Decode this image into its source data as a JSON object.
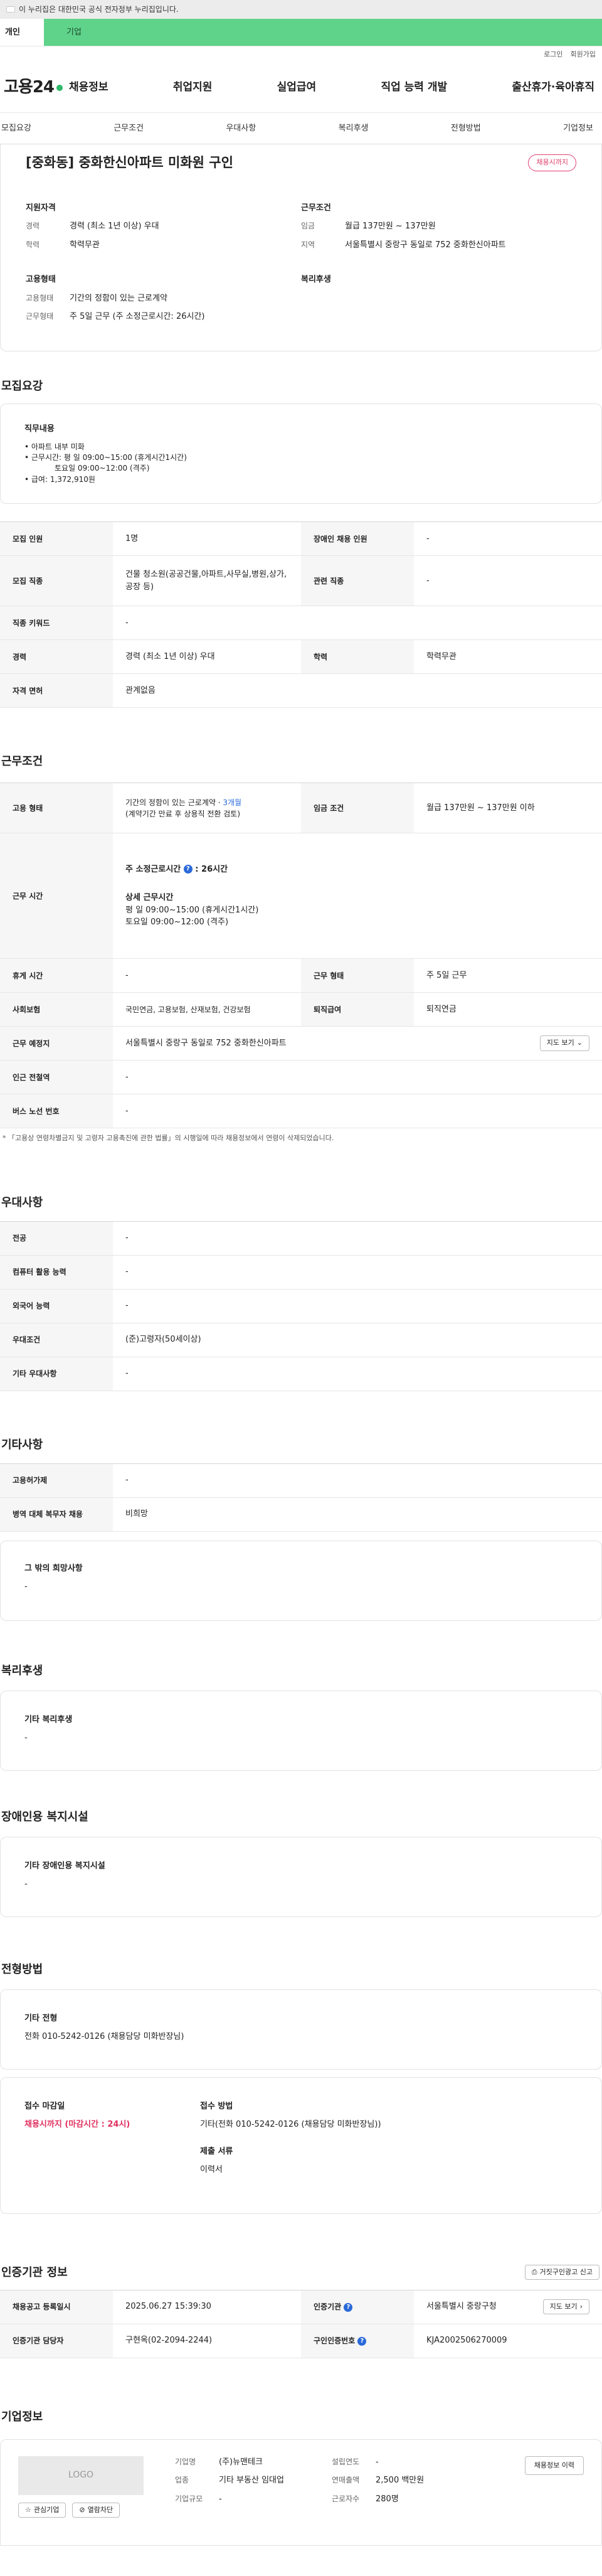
{
  "gov_banner": "이 누리집은 대한민국 공식 전자정부 누리집입니다.",
  "site_tabs": {
    "personal": "개인",
    "company": "기업"
  },
  "util": {
    "login": "로그인",
    "join": "회원가입"
  },
  "logo": "고용24",
  "gnb": [
    "채용정보",
    "취업지원",
    "실업급여",
    "직업 능력 개발",
    "출산휴가·육아휴직"
  ],
  "snb": [
    "모집요강",
    "근무조건",
    "우대사항",
    "복리후생",
    "전형방법",
    "기업정보"
  ],
  "title": "[중화동] 중화한신아파트 미화원 구인",
  "status_badge": "채용시까지",
  "summary": {
    "qual_title": "지원자격",
    "career_k": "경력",
    "career_v": "경력 (최소 1년 이상) 우대",
    "edu_k": "학력",
    "edu_v": "학력무관",
    "cond_title": "근무조건",
    "wage_k": "임금",
    "wage_v": "월급 137만원 ~ 137만원",
    "region_k": "지역",
    "region_v": "서울특별시 중랑구 동일로 752 중화한신아파트",
    "form_title": "고용형태",
    "emp_k": "고용형태",
    "emp_v": "기간의 정함이 있는 근로계약",
    "work_k": "근무형태",
    "work_v": "주 5일 근무 (주 소정근로시간: 26시간)",
    "welfare_title": "복리후생"
  },
  "recruit": {
    "title": "모집요강",
    "duty_title": "직무내용",
    "duty_lines": [
      "• 아파트 내부 미화",
      "• 근무시간: 평    일 09:00~15:00 (휴게시간1시간)",
      "토요일 09:00~12:00 (격주)",
      "• 급여: 1,372,910원"
    ],
    "rows": {
      "count_k": "모집 인원",
      "count_v": "1명",
      "disabled_k": "장애인 채용 인원",
      "disabled_v": "-",
      "job_k": "모집 직종",
      "job_v": "건물 청소원(공공건물,아파트,사무실,병원,상가,공장 등)",
      "related_k": "관련 직종",
      "related_v": "-",
      "keyword_k": "직종 키워드",
      "keyword_v": "-",
      "career_k": "경력",
      "career_v": "경력 (최소 1년 이상) 우대",
      "edu_k": "학력",
      "edu_v": "학력무관",
      "license_k": "자격 면허",
      "license_v": "관계없음"
    }
  },
  "work": {
    "title": "근무조건",
    "emp_k": "고용 형태",
    "emp_v1": "기간의 정함이 있는 근로계약 · ",
    "emp_v1b": "3개월",
    "emp_v2": "(계약기간 만료 후 상용직 전환 검토)",
    "wage_k": "임금 조건",
    "wage_v": "월급 137만원 ~ 137만원 이하",
    "time_k": "근무 시간",
    "hours_label": "주 소정근로시간",
    "hours_value": "26시간",
    "detail_title": "상세 근무시간",
    "detail_1": "평    일 09:00~15:00 (휴게시간1시간)",
    "detail_2": "토요일 09:00~12:00 (격주)",
    "rest_k": "휴게 시간",
    "rest_v": "-",
    "form_k": "근무 형태",
    "form_v": "주 5일 근무",
    "ins_k": "사회보험",
    "ins_v": "국민연금, 고용보험, 산재보험, 건강보험",
    "retire_k": "퇴직급여",
    "retire_v": "퇴직연금",
    "place_k": "근무 예정지",
    "place_v": "서울특별시 중랑구 동일로 752 중화한신아파트",
    "map_btn": "지도 보기",
    "subway_k": "인근 전철역",
    "subway_v": "-",
    "bus_k": "버스 노선 번호",
    "bus_v": "-",
    "note": "* 「고용상 연령차별금지 및 고령자 고용촉진에 관한 법률」의 시행일에 따라 채용정보에서 연령이 삭제되었습니다."
  },
  "prefer": {
    "title": "우대사항",
    "major_k": "전공",
    "major_v": "-",
    "pc_k": "컴퓨터 활용 능력",
    "pc_v": "-",
    "lang_k": "외국어 능력",
    "lang_v": "-",
    "cond_k": "우대조건",
    "cond_v": "(준)고령자(50세이상)",
    "etc_k": "기타 우대사항",
    "etc_v": "-"
  },
  "other": {
    "title": "기타사항",
    "emp_k": "고용허가제",
    "emp_v": "-",
    "mil_k": "병역 대체 복무자 채용",
    "mil_v": "비희망",
    "wish_title": "그 밖의 희망사항",
    "wish_v": "-"
  },
  "welfare": {
    "title": "복리후생",
    "box_title": "기타 복리후생",
    "box_v": "-"
  },
  "disabled_fac": {
    "title": "장애인용 복지시설",
    "box_title": "기타 장애인용 복지시설",
    "box_v": "-"
  },
  "selection": {
    "title": "전형방법",
    "etc_title": "기타 전형",
    "etc_v": "전화 010-5242-0126 (채용담당 미화반장님)",
    "deadline_title": "접수 마감일",
    "deadline_v": "채용시까지 (마감시간 : 24시)",
    "method_title": "접수 방법",
    "method_v": "기타(전화 010-5242-0126 (채용담당 미화반장님))",
    "docs_title": "제출 서류",
    "docs_v": "이력서"
  },
  "agency": {
    "title": "인증기관 정보",
    "report_btn": "거짓구인광고 신고",
    "reg_k": "채용공고 등록일시",
    "reg_v": "2025.06.27 15:39:30",
    "agency_k": "인증기관",
    "agency_v": "서울특별시 중랑구청",
    "map_btn": "지도 보기",
    "manager_k": "인증기관 담당자",
    "manager_v": "구현옥(02-2094-2244)",
    "cert_k": "구인인증번호",
    "cert_v": "KJA2002506270009"
  },
  "company": {
    "title": "기업정보",
    "logo": "LOGO",
    "fav_btn": "관심기업",
    "block_btn": "열람차단",
    "name_k": "기업명",
    "name_v": "(주)뉴맨테크",
    "industry_k": "업종",
    "industry_v": "기타 부동산 임대업",
    "size_k": "기업규모",
    "size_v": "-",
    "founded_k": "설립연도",
    "founded_v": "-",
    "sales_k": "연매출액",
    "sales_v": "2,500 백만원",
    "staff_k": "근로자수",
    "staff_v": "280명",
    "history_btn": "채용정보 이력"
  }
}
